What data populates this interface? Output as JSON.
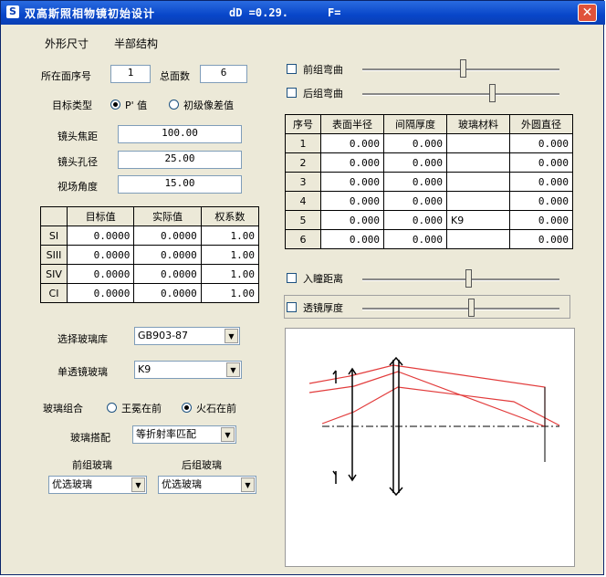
{
  "window": {
    "title": "双高斯照相物镜初始设计",
    "dD_label": "dD =0.29.",
    "F_label": "F=",
    "close_label": "✕"
  },
  "menu": {
    "item1": "外形尺寸",
    "item2": "半部结构"
  },
  "params": {
    "surface_index_label": "所在面序号",
    "surface_index_value": "1",
    "total_surfaces_label": "总面数",
    "total_surfaces_value": "6",
    "target_type_label": "目标类型",
    "target_opt1": "P' 值",
    "target_opt2": "初级像差值",
    "focal_label": "镜头焦距",
    "focal_value": "100.00",
    "aperture_label": "镜头孔径",
    "aperture_value": "25.00",
    "fov_label": "视场角度",
    "fov_value": "15.00"
  },
  "aberration_table": {
    "headers": [
      "",
      "目标值",
      "实际值",
      "权系数"
    ],
    "rows": [
      [
        "SI",
        "0.0000",
        "0.0000",
        "1.00"
      ],
      [
        "SIII",
        "0.0000",
        "0.0000",
        "1.00"
      ],
      [
        "SIV",
        "0.0000",
        "0.0000",
        "1.00"
      ],
      [
        "CI",
        "0.0000",
        "0.0000",
        "1.00"
      ]
    ]
  },
  "glass": {
    "library_label": "选择玻璃库",
    "library_value": "GB903-87",
    "single_lens_label": "单透镜玻璃",
    "single_lens_value": "K9",
    "combo_label": "玻璃组合",
    "combo_opt1": "王冕在前",
    "combo_opt2": "火石在前",
    "match_label": "玻璃搭配",
    "match_value": "等折射率匹配",
    "front_label": "前组玻璃",
    "front_value": "优选玻璃",
    "rear_label": "后组玻璃",
    "rear_value": "优选玻璃"
  },
  "sliders": {
    "front_bend": "前组弯曲",
    "rear_bend": "后组弯曲",
    "pupil_distance": "入瞳距离",
    "lens_thickness": "透镜厚度",
    "front_bend_level": 0.52,
    "rear_bend_level": 0.6,
    "pupil_distance_level": 0.52,
    "lens_thickness_level": 0.52
  },
  "surface_table": {
    "headers": [
      "序号",
      "表面半径",
      "间隔厚度",
      "玻璃材料",
      "外圆直径"
    ],
    "rows": [
      [
        "1",
        "0.000",
        "0.000",
        "",
        "0.000"
      ],
      [
        "2",
        "0.000",
        "0.000",
        "",
        "0.000"
      ],
      [
        "3",
        "0.000",
        "0.000",
        "",
        "0.000"
      ],
      [
        "4",
        "0.000",
        "0.000",
        "",
        "0.000"
      ],
      [
        "5",
        "0.000",
        "0.000",
        "K9",
        "0.000"
      ],
      [
        "6",
        "0.000",
        "0.000",
        "",
        "0.000"
      ]
    ]
  },
  "colors": {
    "ray": "#e23b3b",
    "title_bar": "#0846c9",
    "panel": "#ece9d8"
  }
}
